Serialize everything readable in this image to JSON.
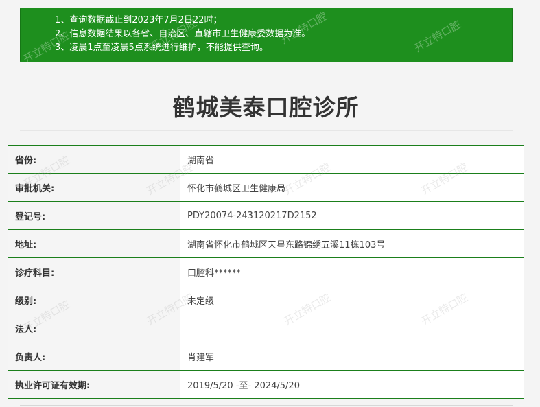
{
  "notice": {
    "lines": [
      "1、查询数据截止到2023年7月2日22时；",
      "2、信息数据结果以各省、自治区、直辖市卫生健康委数据为准。",
      "3、凌晨1点至凌晨5点系统进行维护，不能提供查询。"
    ]
  },
  "watermark": "开立特口腔",
  "title": "鹤城美泰口腔诊所",
  "rows": [
    {
      "label": "省份:",
      "value": "湖南省"
    },
    {
      "label": "审批机关:",
      "value": "怀化市鹤城区卫生健康局"
    },
    {
      "label": "登记号:",
      "value": "PDY20074-243120217D2152"
    },
    {
      "label": "地址:",
      "value": "湖南省怀化市鹤城区天星东路锦绣五溪11栋103号"
    },
    {
      "label": "诊疗科目:",
      "value": "口腔科******"
    },
    {
      "label": "级别:",
      "value": "未定级"
    },
    {
      "label": "法人:",
      "value": ""
    },
    {
      "label": "负责人:",
      "value": "肖建军"
    },
    {
      "label": "执业许可证有效期:",
      "value": "2019/5/20 -至- 2024/5/20"
    }
  ],
  "colors": {
    "notice_bg": "#1e8f1e",
    "row_border": "#1b7f1b"
  }
}
